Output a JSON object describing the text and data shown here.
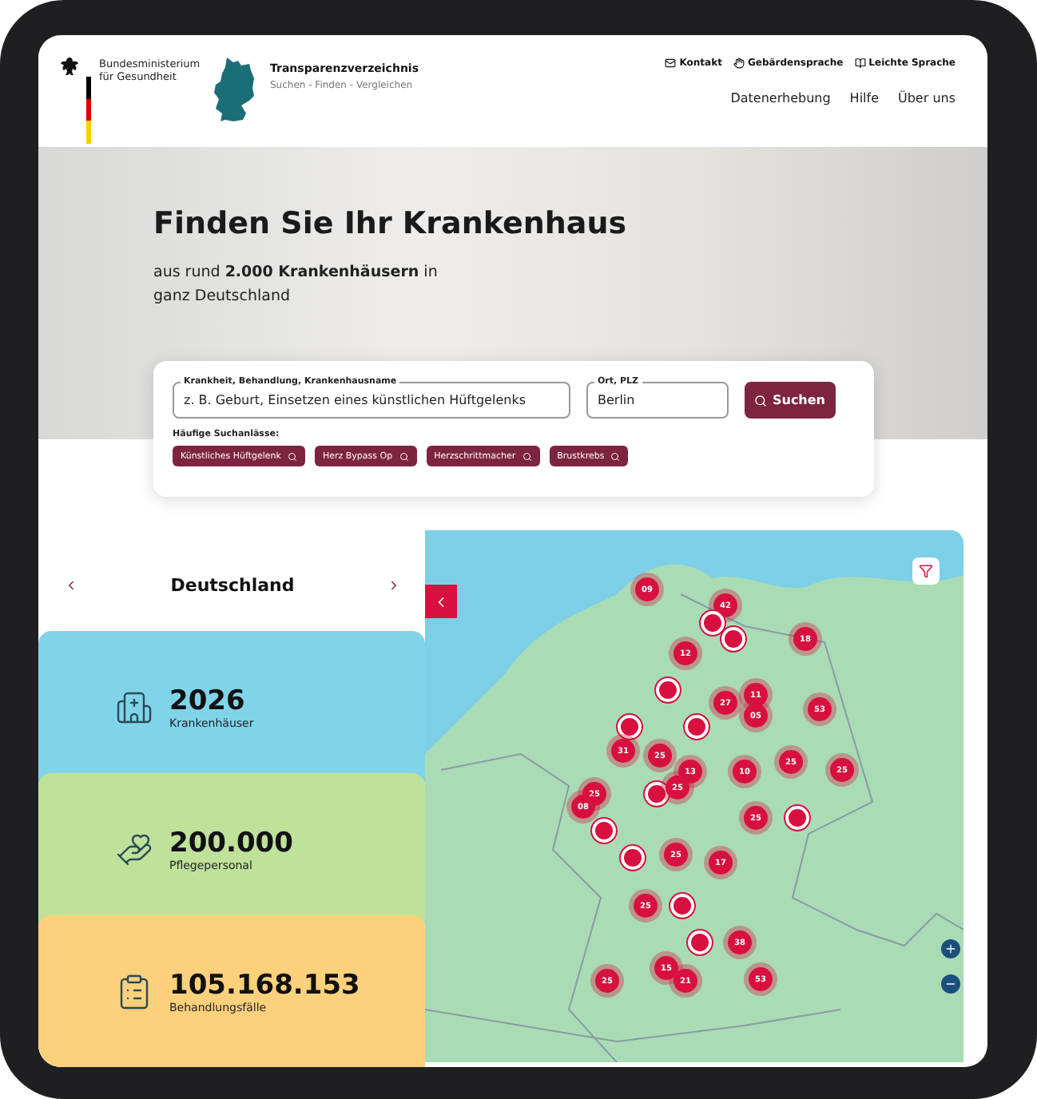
{
  "header": {
    "ministry": "Bundesministerium für Gesundheit",
    "brand_title": "Transparenzverzeichnis",
    "brand_subtitle": "Suchen - Finden - Vergleichen",
    "service_links": [
      {
        "kind": "mail",
        "label": "Kontakt"
      },
      {
        "kind": "hand",
        "label": "Gebärdensprache"
      },
      {
        "kind": "book",
        "label": "Leichte Sprache"
      }
    ],
    "nav": [
      "Datenerhebung",
      "Hilfe",
      "Über uns"
    ]
  },
  "hero": {
    "title": "Finden Sie Ihr Krankenhaus",
    "subtitle": "aus rund **2.000 Krankenhäusern** in ganz Deutschland"
  },
  "search": {
    "query_label": "Krankheit, Behandlung, Krankenhausname",
    "query_placeholder": "z. B. Geburt, Einsetzen eines künstlichen Hüftgelenks",
    "place_label": "Ort, PLZ",
    "place_value": "Berlin",
    "button": "Suchen",
    "frequent_label": "Häufige Suchanlässe:",
    "frequent": [
      "Künstliches Hüftgelenk",
      "Herz Bypass Op",
      "Herzschrittmacher",
      "Brustkrebs"
    ]
  },
  "region": {
    "name": "Deutschland"
  },
  "stats": [
    {
      "kind": "hospital",
      "value": "2026",
      "label": "Krankenhäuser",
      "color": "#80d4e9"
    },
    {
      "kind": "care",
      "value": "200.000",
      "label": "Pflegepersonal",
      "color": "#bfe19a"
    },
    {
      "kind": "cases",
      "value": "105.168.153",
      "label": "Behandlungsfälle",
      "color": "#fdd17c"
    }
  ],
  "map": {
    "markers": [
      {
        "kind": "cluster",
        "count": "09"
      },
      {
        "kind": "cluster",
        "count": "42"
      },
      {
        "kind": "single"
      },
      {
        "kind": "single"
      },
      {
        "kind": "cluster",
        "count": "18"
      },
      {
        "kind": "cluster",
        "count": "12"
      },
      {
        "kind": "single"
      },
      {
        "kind": "cluster",
        "count": "27"
      },
      {
        "kind": "cluster",
        "count": "11"
      },
      {
        "kind": "cluster",
        "count": "05"
      },
      {
        "kind": "cluster",
        "count": "53"
      },
      {
        "kind": "single"
      },
      {
        "kind": "single"
      },
      {
        "kind": "cluster",
        "count": "31"
      },
      {
        "kind": "cluster",
        "count": "25"
      },
      {
        "kind": "cluster",
        "count": "13"
      },
      {
        "kind": "cluster",
        "count": "10"
      },
      {
        "kind": "cluster",
        "count": "25"
      },
      {
        "kind": "cluster",
        "count": "25"
      },
      {
        "kind": "cluster",
        "count": "25"
      },
      {
        "kind": "cluster",
        "count": "08"
      },
      {
        "kind": "single"
      },
      {
        "kind": "cluster",
        "count": "25"
      },
      {
        "kind": "cluster",
        "count": "25"
      },
      {
        "kind": "single"
      },
      {
        "kind": "single"
      },
      {
        "kind": "single"
      },
      {
        "kind": "cluster",
        "count": "25"
      },
      {
        "kind": "cluster",
        "count": "17"
      },
      {
        "kind": "cluster",
        "count": "25"
      },
      {
        "kind": "single"
      },
      {
        "kind": "single"
      },
      {
        "kind": "cluster",
        "count": "38"
      },
      {
        "kind": "cluster",
        "count": "15"
      },
      {
        "kind": "cluster",
        "count": "25"
      },
      {
        "kind": "cluster",
        "count": "21"
      },
      {
        "kind": "cluster",
        "count": "53"
      }
    ]
  }
}
